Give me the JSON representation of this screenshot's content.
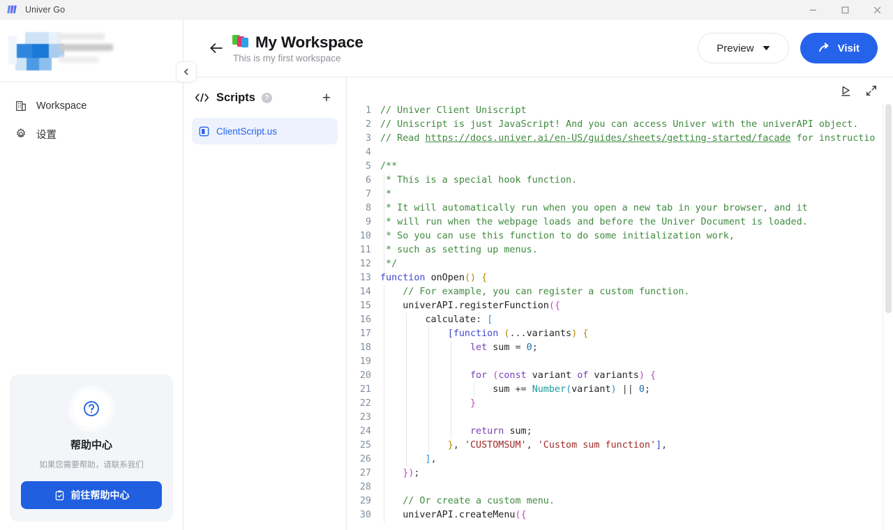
{
  "window": {
    "app_title": "Univer Go",
    "controls": {
      "minimize": "–",
      "maximize": "□",
      "close": "✕"
    }
  },
  "sidebar": {
    "user_name_hidden": "",
    "items": [
      {
        "label": "Workspace",
        "icon": "building-icon"
      },
      {
        "label": "设置",
        "icon": "gear-icon"
      }
    ],
    "help_card": {
      "icon": "question-circle-icon",
      "title": "帮助中心",
      "subtitle": "如果您需要帮助，请联系我们",
      "button_label": "前往帮助中心",
      "button_icon": "clipboard-check-icon",
      "button_color": "#1f5fe0"
    },
    "collapse_icon": "chevron-left-icon"
  },
  "header": {
    "back_icon": "arrow-left-icon",
    "workspace_icon": "stacked-squares-icon",
    "title": "My Workspace",
    "subtitle": "This is my first workspace",
    "preview_label": "Preview",
    "preview_caret": "chevron-down-icon",
    "visit_label": "Visit",
    "visit_icon": "arrow-share-icon",
    "visit_color": "#2563eb"
  },
  "scripts_panel": {
    "icon": "code-brackets-icon",
    "title": "Scripts",
    "help_icon": "question-mark-icon",
    "help_glyph": "?",
    "add_icon": "plus-icon",
    "add_glyph": "+",
    "files": [
      {
        "name": "ClientScript.us",
        "icon": "script-file-icon",
        "selected": true
      }
    ]
  },
  "editor": {
    "toolbar": [
      {
        "icon": "run-script-icon"
      },
      {
        "icon": "expand-fullscreen-icon"
      }
    ],
    "first_line": 1,
    "lines": [
      {
        "n": 1,
        "tokens": [
          {
            "t": "// Univer Client Uniscript",
            "c": "cm"
          }
        ]
      },
      {
        "n": 2,
        "tokens": [
          {
            "t": "// Uniscript is just JavaScript! And you can access Univer with the univerAPI object.",
            "c": "cm"
          }
        ]
      },
      {
        "n": 3,
        "tokens": [
          {
            "t": "// Read ",
            "c": "cm"
          },
          {
            "t": "https://docs.univer.ai/en-US/guides/sheets/getting-started/facade",
            "c": "lnk"
          },
          {
            "t": " for instructio",
            "c": "cm"
          }
        ]
      },
      {
        "n": 4,
        "tokens": []
      },
      {
        "n": 5,
        "tokens": [
          {
            "t": "/**",
            "c": "cm"
          }
        ]
      },
      {
        "n": 6,
        "tokens": [
          {
            "t": " * This is a special hook function.",
            "c": "cm"
          }
        ]
      },
      {
        "n": 7,
        "tokens": [
          {
            "t": " *",
            "c": "cm"
          }
        ]
      },
      {
        "n": 8,
        "tokens": [
          {
            "t": " * It will automatically run when you open a new tab in your browser, and it",
            "c": "cm"
          }
        ]
      },
      {
        "n": 9,
        "tokens": [
          {
            "t": " * will run when the webpage loads and before the Univer Document is loaded.",
            "c": "cm"
          }
        ]
      },
      {
        "n": 10,
        "tokens": [
          {
            "t": " * So you can use this function to do some initialization work,",
            "c": "cm"
          }
        ]
      },
      {
        "n": 11,
        "tokens": [
          {
            "t": " * such as setting up menus.",
            "c": "cm"
          }
        ]
      },
      {
        "n": 12,
        "tokens": [
          {
            "t": " */",
            "c": "cm"
          }
        ]
      },
      {
        "n": 13,
        "tokens": [
          {
            "t": "function",
            "c": "kw"
          },
          {
            "t": " ",
            "c": "pn"
          },
          {
            "t": "onOpen",
            "c": "fn"
          },
          {
            "t": "(",
            "c": "b1"
          },
          {
            "t": ")",
            "c": "b1"
          },
          {
            "t": " ",
            "c": "pn"
          },
          {
            "t": "{",
            "c": "b1"
          }
        ]
      },
      {
        "n": 14,
        "tokens": [
          {
            "t": "    ",
            "c": "pn"
          },
          {
            "t": "// For example, you can register a custom function.",
            "c": "cm"
          }
        ]
      },
      {
        "n": 15,
        "tokens": [
          {
            "t": "    ",
            "c": "pn"
          },
          {
            "t": "univerAPI",
            "c": "id"
          },
          {
            "t": ".",
            "c": "pn"
          },
          {
            "t": "registerFunction",
            "c": "fn"
          },
          {
            "t": "(",
            "c": "b2"
          },
          {
            "t": "{",
            "c": "b2"
          }
        ]
      },
      {
        "n": 16,
        "tokens": [
          {
            "t": "        ",
            "c": "pn"
          },
          {
            "t": "calculate",
            "c": "id"
          },
          {
            "t": ": ",
            "c": "pn"
          },
          {
            "t": "[",
            "c": "b3"
          }
        ]
      },
      {
        "n": 17,
        "tokens": [
          {
            "t": "            ",
            "c": "pn"
          },
          {
            "t": "[",
            "c": "b4"
          },
          {
            "t": "function",
            "c": "kw"
          },
          {
            "t": " ",
            "c": "pn"
          },
          {
            "t": "(",
            "c": "b1"
          },
          {
            "t": "...",
            "c": "pn"
          },
          {
            "t": "variants",
            "c": "id"
          },
          {
            "t": ")",
            "c": "b1"
          },
          {
            "t": " ",
            "c": "pn"
          },
          {
            "t": "{",
            "c": "b1"
          }
        ]
      },
      {
        "n": 18,
        "tokens": [
          {
            "t": "                ",
            "c": "pn"
          },
          {
            "t": "let",
            "c": "kw2"
          },
          {
            "t": " ",
            "c": "pn"
          },
          {
            "t": "sum",
            "c": "id"
          },
          {
            "t": " = ",
            "c": "pn"
          },
          {
            "t": "0",
            "c": "num"
          },
          {
            "t": ";",
            "c": "pn"
          }
        ]
      },
      {
        "n": 19,
        "tokens": []
      },
      {
        "n": 20,
        "tokens": [
          {
            "t": "                ",
            "c": "pn"
          },
          {
            "t": "for",
            "c": "kw2"
          },
          {
            "t": " ",
            "c": "pn"
          },
          {
            "t": "(",
            "c": "b2"
          },
          {
            "t": "const",
            "c": "kw2"
          },
          {
            "t": " ",
            "c": "pn"
          },
          {
            "t": "variant",
            "c": "id"
          },
          {
            "t": " ",
            "c": "pn"
          },
          {
            "t": "of",
            "c": "kw2"
          },
          {
            "t": " ",
            "c": "pn"
          },
          {
            "t": "variants",
            "c": "id"
          },
          {
            "t": ")",
            "c": "b2"
          },
          {
            "t": " ",
            "c": "pn"
          },
          {
            "t": "{",
            "c": "b2"
          }
        ]
      },
      {
        "n": 21,
        "tokens": [
          {
            "t": "                    ",
            "c": "pn"
          },
          {
            "t": "sum",
            "c": "id"
          },
          {
            "t": " += ",
            "c": "pn"
          },
          {
            "t": "Number",
            "c": "ty"
          },
          {
            "t": "(",
            "c": "b3"
          },
          {
            "t": "variant",
            "c": "id"
          },
          {
            "t": ")",
            "c": "b3"
          },
          {
            "t": " || ",
            "c": "pn"
          },
          {
            "t": "0",
            "c": "num"
          },
          {
            "t": ";",
            "c": "pn"
          }
        ]
      },
      {
        "n": 22,
        "tokens": [
          {
            "t": "                ",
            "c": "pn"
          },
          {
            "t": "}",
            "c": "b2"
          }
        ]
      },
      {
        "n": 23,
        "tokens": []
      },
      {
        "n": 24,
        "tokens": [
          {
            "t": "                ",
            "c": "pn"
          },
          {
            "t": "return",
            "c": "kw2"
          },
          {
            "t": " ",
            "c": "pn"
          },
          {
            "t": "sum",
            "c": "id"
          },
          {
            "t": ";",
            "c": "pn"
          }
        ]
      },
      {
        "n": 25,
        "tokens": [
          {
            "t": "            ",
            "c": "pn"
          },
          {
            "t": "}",
            "c": "b1"
          },
          {
            "t": ", ",
            "c": "pn"
          },
          {
            "t": "'CUSTOMSUM'",
            "c": "str"
          },
          {
            "t": ", ",
            "c": "pn"
          },
          {
            "t": "'Custom sum function'",
            "c": "str"
          },
          {
            "t": "]",
            "c": "b4"
          },
          {
            "t": ",",
            "c": "pn"
          }
        ]
      },
      {
        "n": 26,
        "tokens": [
          {
            "t": "        ",
            "c": "pn"
          },
          {
            "t": "]",
            "c": "b3"
          },
          {
            "t": ",",
            "c": "pn"
          }
        ]
      },
      {
        "n": 27,
        "tokens": [
          {
            "t": "    ",
            "c": "pn"
          },
          {
            "t": "}",
            "c": "b2"
          },
          {
            "t": ")",
            "c": "b2"
          },
          {
            "t": ";",
            "c": "pn"
          }
        ]
      },
      {
        "n": 28,
        "tokens": []
      },
      {
        "n": 29,
        "tokens": [
          {
            "t": "    ",
            "c": "pn"
          },
          {
            "t": "// Or create a custom menu.",
            "c": "cm"
          }
        ]
      },
      {
        "n": 30,
        "tokens": [
          {
            "t": "    ",
            "c": "pn"
          },
          {
            "t": "univerAPI",
            "c": "id"
          },
          {
            "t": ".",
            "c": "pn"
          },
          {
            "t": "createMenu",
            "c": "fn"
          },
          {
            "t": "(",
            "c": "b2"
          },
          {
            "t": "{",
            "c": "b2"
          }
        ]
      }
    ],
    "indent_guides_by_line": {
      "6": [
        1
      ],
      "7": [
        1
      ],
      "8": [
        1
      ],
      "9": [
        1
      ],
      "10": [
        1
      ],
      "11": [
        1
      ],
      "12": [
        1
      ],
      "14": [
        1
      ],
      "15": [
        1
      ],
      "16": [
        1,
        2
      ],
      "17": [
        1,
        2,
        3
      ],
      "18": [
        1,
        2,
        3,
        4
      ],
      "19": [
        1,
        2,
        3,
        4
      ],
      "20": [
        1,
        2,
        3,
        4
      ],
      "21": [
        1,
        2,
        3,
        4,
        5
      ],
      "22": [
        1,
        2,
        3,
        4
      ],
      "23": [
        1,
        2,
        3,
        4
      ],
      "24": [
        1,
        2,
        3,
        4
      ],
      "25": [
        1,
        2,
        3
      ],
      "26": [
        1,
        2
      ],
      "27": [
        1
      ],
      "28": [
        1
      ],
      "29": [
        1
      ],
      "30": [
        1
      ]
    }
  }
}
